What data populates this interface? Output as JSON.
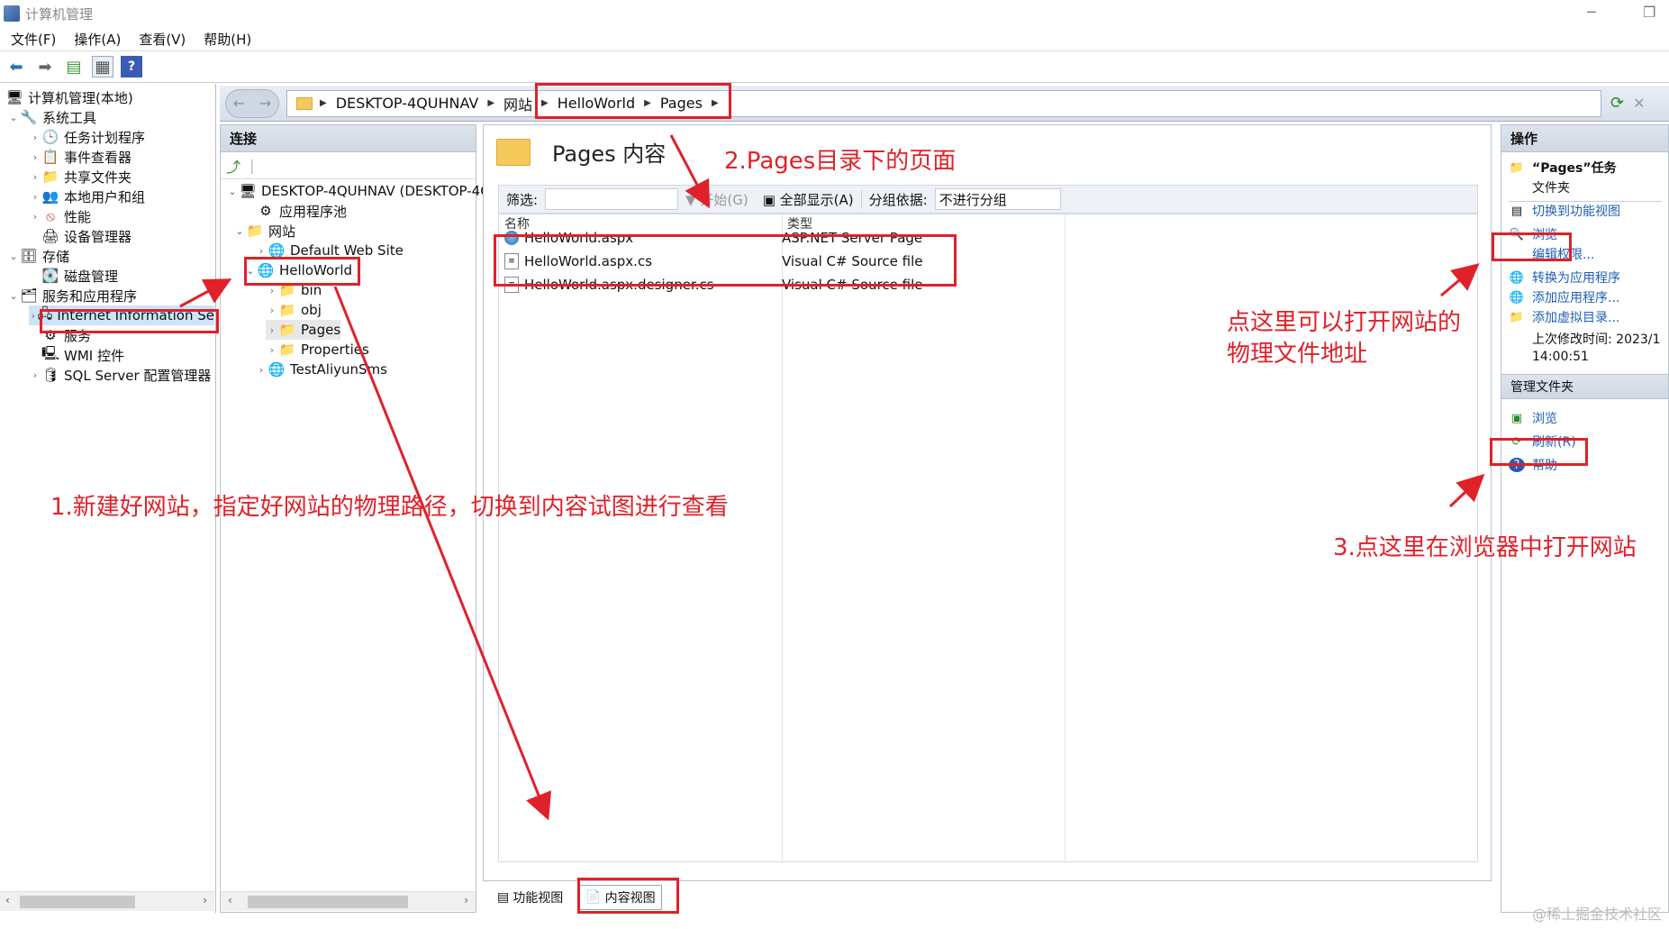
{
  "window": {
    "title": "计算机管理",
    "minimize_icon": "minimize-icon",
    "restore_icon": "restore-icon"
  },
  "menu": [
    "文件(F)",
    "操作(A)",
    "查看(V)",
    "帮助(H)"
  ],
  "left_tree": {
    "root": "计算机管理(本地)",
    "items": [
      {
        "label": "系统工具"
      },
      {
        "label": "任务计划程序"
      },
      {
        "label": "事件查看器"
      },
      {
        "label": "共享文件夹"
      },
      {
        "label": "本地用户和组"
      },
      {
        "label": "性能"
      },
      {
        "label": "设备管理器"
      },
      {
        "label": "存储"
      },
      {
        "label": "磁盘管理"
      },
      {
        "label": "服务和应用程序"
      },
      {
        "label": "Internet Information Se"
      },
      {
        "label": "服务"
      },
      {
        "label": "WMI 控件"
      },
      {
        "label": "SQL Server 配置管理器"
      }
    ]
  },
  "address": {
    "crumbs": [
      "DESKTOP-4QUHNAV",
      "网站",
      "HelloWorld",
      "Pages"
    ]
  },
  "connections": {
    "header": "连接",
    "items": [
      {
        "label": "DESKTOP-4QUHNAV (DESKTOP-4Q"
      },
      {
        "label": "应用程序池"
      },
      {
        "label": "网站"
      },
      {
        "label": "Default Web Site"
      },
      {
        "label": "HelloWorld"
      },
      {
        "label": "bin"
      },
      {
        "label": "obj"
      },
      {
        "label": "Pages"
      },
      {
        "label": "Properties"
      },
      {
        "label": "TestAliyunSms"
      }
    ]
  },
  "content": {
    "title": "Pages 内容",
    "filter_label": "筛选:",
    "go_label": "开始(G)",
    "show_all_label": "全部显示(A)",
    "group_label": "分组依据:",
    "group_value": "不进行分组",
    "columns": [
      "名称",
      "类型"
    ],
    "rows": [
      {
        "name": "HelloWorld.aspx",
        "type": "ASP.NET Server Page"
      },
      {
        "name": "HelloWorld.aspx.cs",
        "type": "Visual C# Source file"
      },
      {
        "name": "HelloWorld.aspx.designer.cs",
        "type": "Visual C# Source file"
      }
    ]
  },
  "view_tabs": [
    "功能视图",
    "内容视图"
  ],
  "actions": {
    "header": "操作",
    "group1_title": "“Pages”任务",
    "group1_sub": "文件夹",
    "switch_feature": "切换到功能视图",
    "browse": "浏览",
    "edit_perm": "编辑权限...",
    "convert": "转换为应用程序",
    "add_app": "添加应用程序...",
    "add_vdir": "添加虚拟目录...",
    "last_modified_label": "上次修改时间: 2023/1",
    "last_modified_time": "14:00:51",
    "group2_title": "管理文件夹",
    "browse2": "浏览",
    "refresh": "刷新(R)",
    "help": "帮助"
  },
  "annotations": {
    "a1": "1.新建好网站，指定好网站的物理路径，切换到内容试图进行查看",
    "a2": "2.Pages目录下的页面",
    "a3_line1": "点这里可以打开网站的",
    "a3_line2": "物理文件地址",
    "a4": "3.点这里在浏览器中打开网站"
  },
  "watermark": "@稀土掘金技术社区"
}
